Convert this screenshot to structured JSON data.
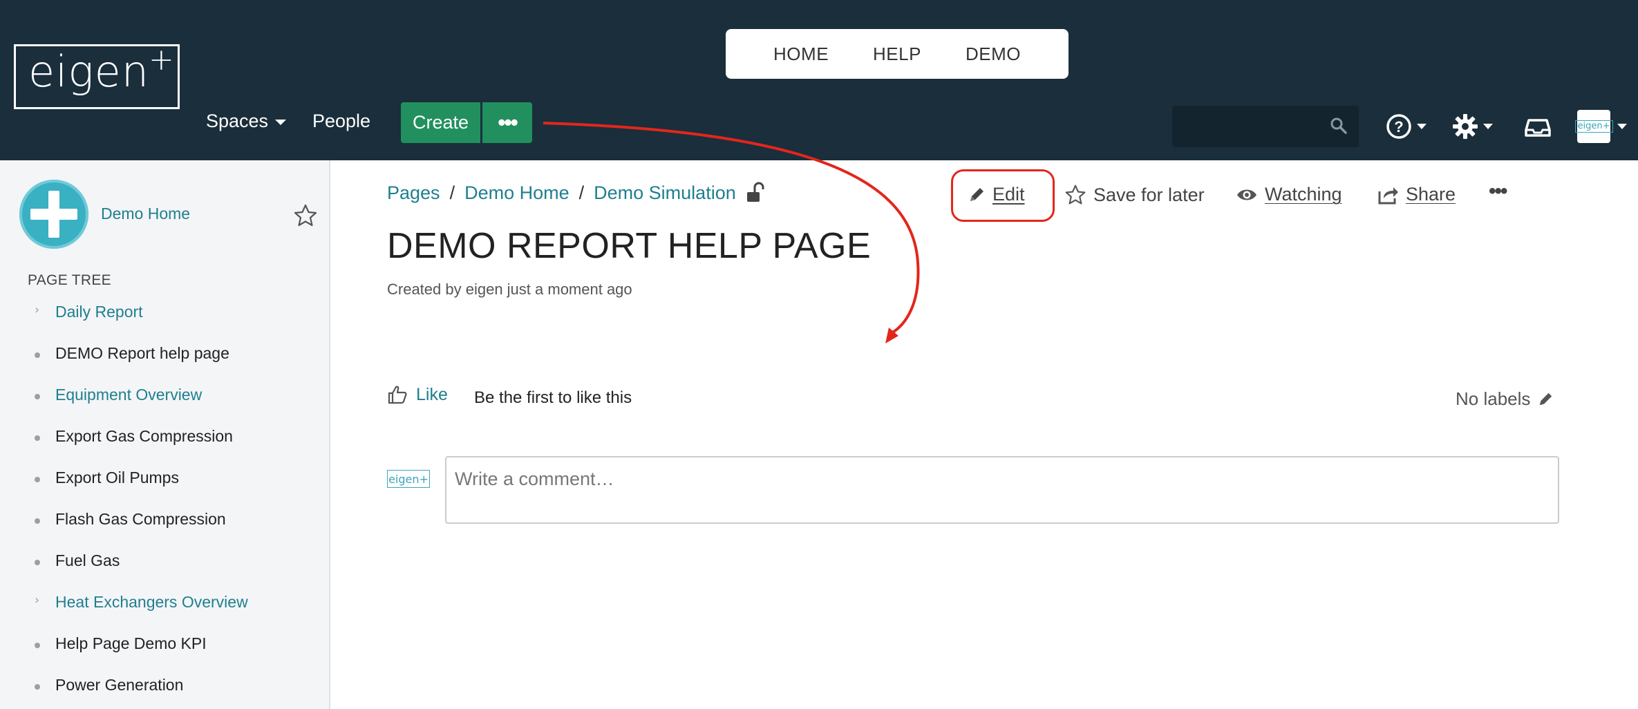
{
  "header": {
    "logo_text": "eigen",
    "logo_plus": "+",
    "top_nav": [
      "HOME",
      "HELP",
      "DEMO"
    ],
    "spaces_label": "Spaces",
    "people_label": "People",
    "create_label": "Create",
    "more_label": "•••",
    "search_icon": "search-icon",
    "help_icon": "question-circle-icon",
    "settings_icon": "gear-icon",
    "inbox_icon": "inbox-tray-icon",
    "avatar_text": "eigen+"
  },
  "sidebar": {
    "space_name": "Demo Home",
    "tree_heading": "PAGE TREE",
    "items": [
      {
        "label": "Daily Report",
        "expandable": true,
        "link": true
      },
      {
        "label": "DEMO Report help page",
        "expandable": false,
        "link": false
      },
      {
        "label": "Equipment Overview",
        "expandable": false,
        "link": true
      },
      {
        "label": "Export Gas Compression",
        "expandable": false,
        "link": false
      },
      {
        "label": "Export Oil Pumps",
        "expandable": false,
        "link": false
      },
      {
        "label": "Flash Gas Compression",
        "expandable": false,
        "link": false
      },
      {
        "label": "Fuel Gas",
        "expandable": false,
        "link": false
      },
      {
        "label": "Heat Exchangers Overview",
        "expandable": true,
        "link": true
      },
      {
        "label": "Help Page Demo KPI",
        "expandable": false,
        "link": false
      },
      {
        "label": "Power Generation",
        "expandable": false,
        "link": false
      }
    ]
  },
  "page": {
    "breadcrumb": [
      "Pages",
      "Demo Home",
      "Demo Simulation"
    ],
    "actions": {
      "edit": "Edit",
      "save_for_later": "Save for later",
      "watching": "Watching",
      "share": "Share",
      "more": "•••"
    },
    "title": "DEMO REPORT HELP PAGE",
    "byline": "Created by eigen just a moment ago",
    "like_label": "Like",
    "like_hint": "Be the first to like this",
    "labels_text": "No labels",
    "comment_avatar": "eigen+",
    "comment_placeholder": "Write a comment…"
  },
  "colors": {
    "header_bg": "#1a2e3b",
    "create_green": "#21905e",
    "link_teal": "#1f7f8f",
    "annotation_red": "#e3261b"
  }
}
